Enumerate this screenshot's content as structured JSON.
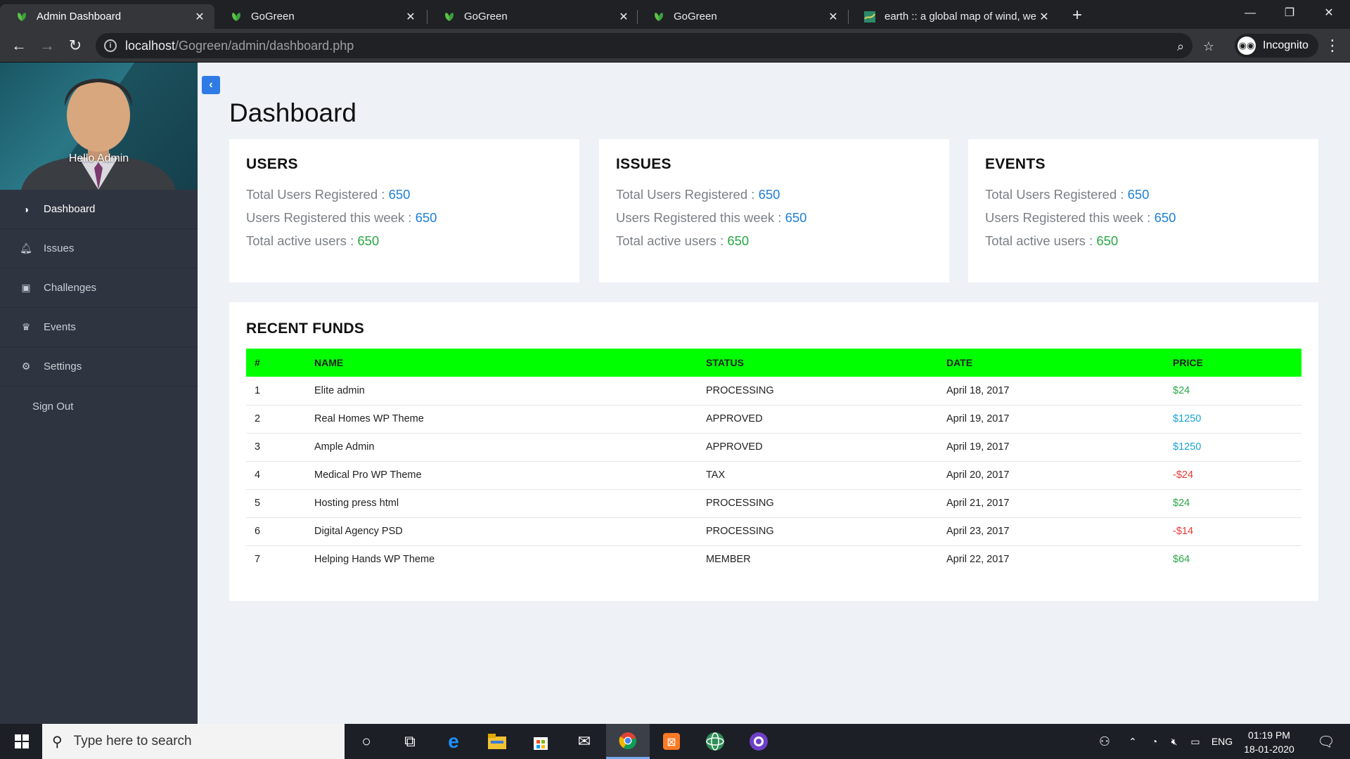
{
  "browser": {
    "tabs": [
      {
        "title": "Admin Dashboard",
        "favicon": "leaf-icon",
        "active": true
      },
      {
        "title": "GoGreen",
        "favicon": "leaf-icon",
        "active": false
      },
      {
        "title": "GoGreen",
        "favicon": "leaf-icon",
        "active": false
      },
      {
        "title": "GoGreen",
        "favicon": "leaf-icon",
        "active": false
      },
      {
        "title": "earth :: a global map of wind, we",
        "favicon": "earth-map-icon",
        "active": false
      }
    ],
    "url_host": "localhost",
    "url_path": "/Gogreen/admin/dashboard.php",
    "profile_label": "Incognito"
  },
  "sidebar": {
    "greeting": "Hello Admin",
    "items": [
      {
        "label": "Dashboard",
        "icon": "half-circle-icon",
        "active": true
      },
      {
        "label": "Issues",
        "icon": "bell-icon",
        "active": false
      },
      {
        "label": "Challenges",
        "icon": "gift-icon",
        "active": false
      },
      {
        "label": "Events",
        "icon": "trophy-icon",
        "active": false
      },
      {
        "label": "Settings",
        "icon": "gear-icon",
        "active": false
      },
      {
        "label": "Sign Out",
        "icon": "",
        "active": false
      }
    ]
  },
  "main": {
    "title": "Dashboard",
    "cards": [
      {
        "title": "USERS",
        "stats": [
          {
            "label": "Total Users Registered : ",
            "value": "650"
          },
          {
            "label": "Users Registered this week : ",
            "value": "650"
          },
          {
            "label": "Total active users : ",
            "value": "650"
          }
        ]
      },
      {
        "title": "ISSUES",
        "stats": [
          {
            "label": "Total Users Registered : ",
            "value": "650"
          },
          {
            "label": "Users Registered this week : ",
            "value": "650"
          },
          {
            "label": "Total active users : ",
            "value": "650"
          }
        ]
      },
      {
        "title": "EVENTS",
        "stats": [
          {
            "label": "Total Users Registered : ",
            "value": "650"
          },
          {
            "label": "Users Registered this week : ",
            "value": "650"
          },
          {
            "label": "Total active users : ",
            "value": "650"
          }
        ]
      }
    ],
    "funds": {
      "title": "RECENT FUNDS",
      "columns": [
        "#",
        "NAME",
        "STATUS",
        "DATE",
        "PRICE"
      ],
      "rows": [
        {
          "num": "1",
          "name": "Elite admin",
          "status": "PROCESSING",
          "date": "April 18, 2017",
          "price": "$24",
          "tone": "pos"
        },
        {
          "num": "2",
          "name": "Real Homes WP Theme",
          "status": "APPROVED",
          "date": "April 19, 2017",
          "price": "$1250",
          "tone": "info-c"
        },
        {
          "num": "3",
          "name": "Ample Admin",
          "status": "APPROVED",
          "date": "April 19, 2017",
          "price": "$1250",
          "tone": "info-c"
        },
        {
          "num": "4",
          "name": "Medical Pro WP Theme",
          "status": "TAX",
          "date": "April 20, 2017",
          "price": "-$24",
          "tone": "neg"
        },
        {
          "num": "5",
          "name": "Hosting press html",
          "status": "PROCESSING",
          "date": "April 21, 2017",
          "price": "$24",
          "tone": "pos"
        },
        {
          "num": "6",
          "name": "Digital Agency PSD",
          "status": "PROCESSING",
          "date": "April 23, 2017",
          "price": "-$14",
          "tone": "neg"
        },
        {
          "num": "7",
          "name": "Helping Hands WP Theme",
          "status": "MEMBER",
          "date": "April 22, 2017",
          "price": "$64",
          "tone": "pos"
        }
      ]
    }
  },
  "taskbar": {
    "search_placeholder": "Type here to search",
    "language": "ENG",
    "time": "01:19 PM",
    "date": "18-01-2020"
  },
  "colors": {
    "sidebar_bg": "#2f3540",
    "table_header_bg": "#00ff00",
    "accent_blue": "#1e7fd6",
    "positive_green": "#28a745",
    "negative_red": "#e53935"
  }
}
